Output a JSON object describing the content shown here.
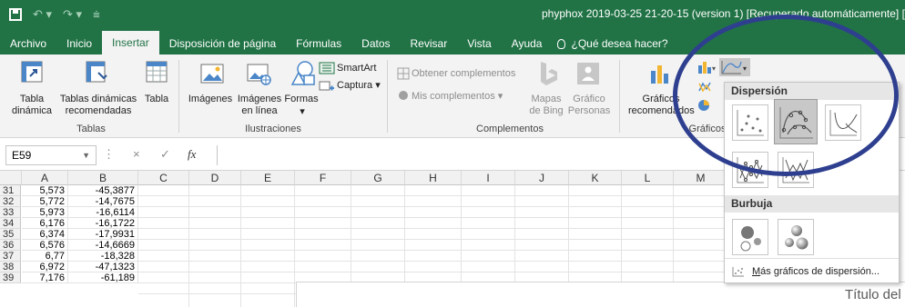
{
  "window": {
    "title": "phyphox 2019-03-25 21-20-15 (version 1) [Recuperado automáticamente] ["
  },
  "menu": {
    "tabs": [
      {
        "label": "Archivo"
      },
      {
        "label": "Inicio"
      },
      {
        "label": "Insertar"
      },
      {
        "label": "Disposición de página"
      },
      {
        "label": "Fórmulas"
      },
      {
        "label": "Datos"
      },
      {
        "label": "Revisar"
      },
      {
        "label": "Vista"
      },
      {
        "label": "Ayuda"
      }
    ],
    "tell_me": "¿Qué desea hacer?"
  },
  "ribbon": {
    "tablas": {
      "tabla_dinamica": "Tabla\ndinámica",
      "tablas_recomendadas": "Tablas dinámicas\nrecomendadas",
      "tabla": "Tabla",
      "group": "Tablas"
    },
    "ilustraciones": {
      "imagenes": "Imágenes",
      "imagenes_linea": "Imágenes\nen línea",
      "formas": "Formas",
      "smartart": "SmartArt",
      "captura": "Captura",
      "group": "Ilustraciones"
    },
    "complementos": {
      "obtener": "Obtener complementos",
      "mis": "Mis complementos",
      "mapas": "Mapas\nde Bing",
      "grafico_personas": "Gráfico\nPersonas",
      "group": "Complementos"
    },
    "graficos": {
      "recomendados": "Gráficos\nrecomendados",
      "group": "Gráficos"
    }
  },
  "formula_bar": {
    "name_box": "E59",
    "cancel": "×",
    "confirm": "✓",
    "fx": "fx"
  },
  "sheet": {
    "columns": [
      "A",
      "B",
      "C",
      "D",
      "E",
      "F",
      "G",
      "H",
      "I",
      "J",
      "K",
      "L",
      "M"
    ],
    "rows": [
      {
        "num": "31",
        "a": "5,573",
        "b": "-45,3877"
      },
      {
        "num": "32",
        "a": "5,772",
        "b": "-14,7675"
      },
      {
        "num": "33",
        "a": "5,973",
        "b": "-16,6114"
      },
      {
        "num": "34",
        "a": "6,176",
        "b": "-16,1722"
      },
      {
        "num": "35",
        "a": "6,374",
        "b": "-17,9931"
      },
      {
        "num": "36",
        "a": "6,576",
        "b": "-14,6669"
      },
      {
        "num": "37",
        "a": "6,77",
        "b": "-18,328"
      },
      {
        "num": "38",
        "a": "6,972",
        "b": "-47,1323"
      },
      {
        "num": "39",
        "a": "7,176",
        "b": "-61,189"
      }
    ],
    "chart_title": "Título del g"
  },
  "dropdown": {
    "dispersion_label": "Dispersión",
    "burbuja_label": "Burbuja",
    "more": "Más gráficos de dispersión...",
    "more_hotkey": "M",
    "more_rest": "ás gráficos de dispersión..."
  },
  "colors": {
    "excel_green": "#217346",
    "highlight_circle": "#2e3f8f"
  }
}
